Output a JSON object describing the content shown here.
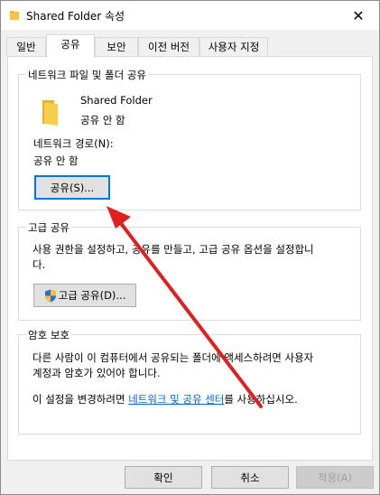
{
  "window": {
    "title": "Shared Folder 속성",
    "close_glyph": "✕"
  },
  "tabs": [
    {
      "label": "일반"
    },
    {
      "label": "공유"
    },
    {
      "label": "보안"
    },
    {
      "label": "이전 버전"
    },
    {
      "label": "사용자 지정"
    }
  ],
  "network_sharing": {
    "group_title": "네트워크 파일 및 폴더 공유",
    "folder_name": "Shared Folder",
    "folder_status": "공유 안 함",
    "path_label": "네트워크 경로(N):",
    "path_value": "공유 안 함",
    "share_button": "공유(S)..."
  },
  "advanced_sharing": {
    "group_title": "고급 공유",
    "description_line1": "사용 권한을 설정하고, 공유를 만들고, 고급 공유 옵션을 설정합니",
    "description_line2": "다.",
    "button": "고급 공유(D)..."
  },
  "password_protection": {
    "group_title": "암호 보호",
    "description_line1": "다른 사람이 이 컴퓨터에서 공유되는 폴더에 액세스하려면 사용자",
    "description_line2": "계정과 암호가 있어야 합니다.",
    "change_prefix": "이 설정을 변경하려면 ",
    "change_link": "네트워크 및 공유 센터",
    "change_suffix": "를 사용하십시오."
  },
  "footer": {
    "ok": "확인",
    "cancel": "취소",
    "apply": "적용(A)"
  },
  "colors": {
    "accent_blue": "#0078d7",
    "annotation_arrow": "#e02020",
    "folder_yellow": "#f5c842"
  },
  "icons": {
    "title": "folder-icon",
    "folder": "folder-icon",
    "shield": "uac-shield-icon",
    "close": "close-icon"
  }
}
